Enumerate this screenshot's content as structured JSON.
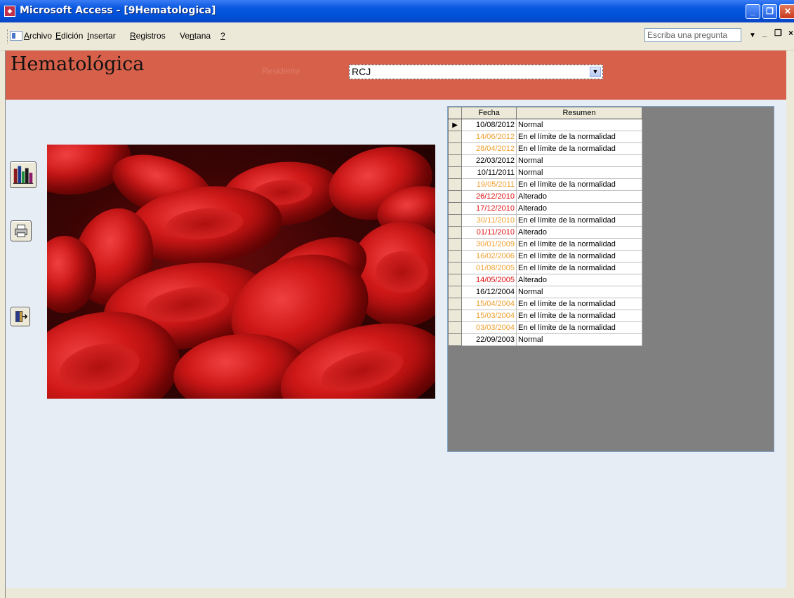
{
  "window": {
    "title": "Microsoft Access - [9Hematologica]",
    "minimize": "_",
    "maximize": "❐",
    "close": "✕"
  },
  "menu": {
    "items": [
      {
        "label": "Archivo",
        "key": "A"
      },
      {
        "label": "Edición",
        "key": "E"
      },
      {
        "label": "Insertar",
        "key": "I"
      },
      {
        "label": "Registros",
        "key": "R"
      },
      {
        "label": "Ventana",
        "key": "n"
      },
      {
        "label": "?",
        "key": "?"
      }
    ],
    "ask_placeholder": "Escriba una pregunta",
    "doc_min": "_",
    "doc_max": "❐",
    "doc_close": "×"
  },
  "form": {
    "heading": "Hematológica",
    "residente_label": "Residente",
    "residente_value": "RCJ"
  },
  "colors": {
    "header": "#d6604a",
    "normal": "#000000",
    "limite": "#f0a030",
    "alterado": "#e01010"
  },
  "sheet": {
    "columns": [
      "Fecha",
      "Resumen"
    ],
    "rows": [
      {
        "fecha": "10/08/2012",
        "resumen": "Normal",
        "status": "normal",
        "current": true
      },
      {
        "fecha": "14/06/2012",
        "resumen": "En el límite de la normalidad",
        "status": "limite"
      },
      {
        "fecha": "28/04/2012",
        "resumen": "En el límite de la normalidad",
        "status": "limite"
      },
      {
        "fecha": "22/03/2012",
        "resumen": "Normal",
        "status": "normal"
      },
      {
        "fecha": "10/11/2011",
        "resumen": "Normal",
        "status": "normal"
      },
      {
        "fecha": "19/05/2011",
        "resumen": "En el límite de la normalidad",
        "status": "limite"
      },
      {
        "fecha": "26/12/2010",
        "resumen": "Alterado",
        "status": "alterado"
      },
      {
        "fecha": "17/12/2010",
        "resumen": "Alterado",
        "status": "alterado"
      },
      {
        "fecha": "30/11/2010",
        "resumen": "En el límite de la normalidad",
        "status": "limite"
      },
      {
        "fecha": "01/11/2010",
        "resumen": "Alterado",
        "status": "alterado"
      },
      {
        "fecha": "30/01/2009",
        "resumen": "En el límite de la normalidad",
        "status": "limite"
      },
      {
        "fecha": "16/02/2006",
        "resumen": "En el límite de la normalidad",
        "status": "limite"
      },
      {
        "fecha": "01/08/2005",
        "resumen": "En el límite de la normalidad",
        "status": "limite"
      },
      {
        "fecha": "14/05/2005",
        "resumen": "Alterado",
        "status": "alterado"
      },
      {
        "fecha": "16/12/2004",
        "resumen": "Normal",
        "status": "normal"
      },
      {
        "fecha": "15/04/2004",
        "resumen": "En el límite de la normalidad",
        "status": "limite"
      },
      {
        "fecha": "15/03/2004",
        "resumen": "En el límite de la normalidad",
        "status": "limite"
      },
      {
        "fecha": "03/03/2004",
        "resumen": "En el límite de la normalidad",
        "status": "limite"
      },
      {
        "fecha": "22/09/2003",
        "resumen": "Normal",
        "status": "normal"
      }
    ]
  },
  "buttons": {
    "chart": "chart-icon",
    "print": "printer-icon",
    "exit": "exit-door-icon"
  },
  "image": {
    "subject": "red-blood-cells-image"
  }
}
